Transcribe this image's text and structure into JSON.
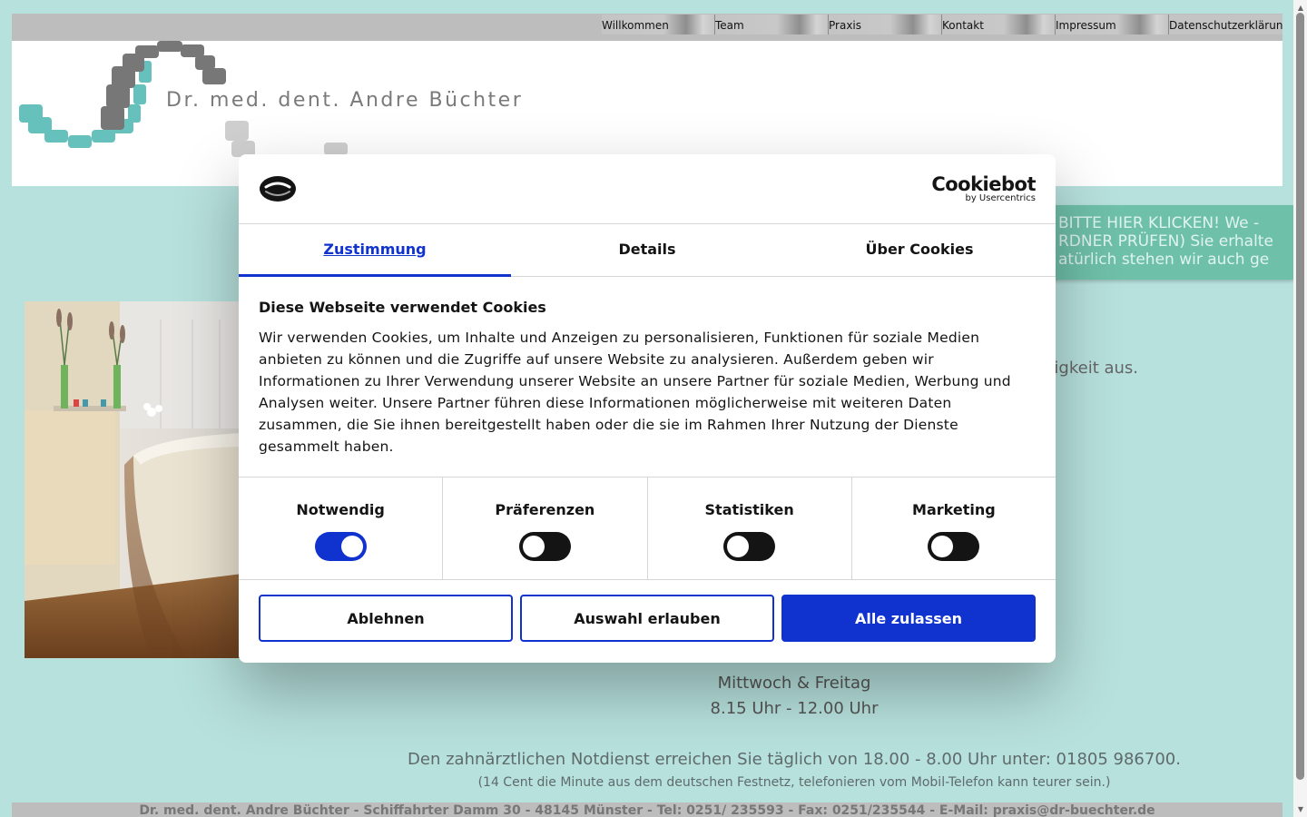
{
  "nav": {
    "items": [
      "Willkommen",
      "Team",
      "Praxis",
      "Kontakt",
      "Impressum",
      "Datenschutzerklärung"
    ]
  },
  "header": {
    "brand_name": "Dr. med. dent. Andre Büchter"
  },
  "banner": {
    "line1": "- BITTE HIER KLICKEN! We",
    "line2": "RDNER PRÜFEN) Sie erhalte",
    "line3": "atürlich stehen wir auch ge"
  },
  "main": {
    "intro_tail": "digkeit aus.",
    "hours_days": "Mittwoch & Freitag",
    "hours_time": "8.15 Uhr - 12.00 Uhr",
    "emergency": "Den zahnärztlichen Notdienst erreichen Sie täglich von 18.00 - 8.00 Uhr unter: 01805 986700.",
    "emergency_note": "(14 Cent die Minute aus dem deutschen Festnetz, telefonieren vom Mobil-Telefon kann teurer sein.)"
  },
  "footer": {
    "text": "Dr. med. dent. Andre Büchter - Schiffahrter Damm 30 - 48145 Münster - Tel: 0251/ 235593 - Fax: 0251/235544 - E-Mail: praxis@dr-buechter.de"
  },
  "cookie_dialog": {
    "brand_main": "Cookiebot",
    "brand_sub": "by Usercentrics",
    "tabs": [
      "Zustimmung",
      "Details",
      "Über Cookies"
    ],
    "active_tab": "Zustimmung",
    "title": "Diese Webseite verwendet Cookies",
    "text": "Wir verwenden Cookies, um Inhalte und Anzeigen zu personalisieren, Funktionen für soziale Medien anbieten zu können und die Zugriffe auf unsere Website zu analysieren. Außerdem geben wir Informationen zu Ihrer Verwendung unserer Website an unsere Partner für soziale Medien, Werbung und Analysen weiter. Unsere Partner führen diese Informationen möglicherweise mit weiteren Daten zusammen, die Sie ihnen bereitgestellt haben oder die sie im Rahmen Ihrer Nutzung der Dienste gesammelt haben.",
    "toggles": [
      {
        "label": "Notwendig",
        "checked": true
      },
      {
        "label": "Präferenzen",
        "checked": false
      },
      {
        "label": "Statistiken",
        "checked": false
      },
      {
        "label": "Marketing",
        "checked": false
      }
    ],
    "buttons": {
      "decline": "Ablehnen",
      "allow_selection": "Auswahl erlauben",
      "allow_all": "Alle zulassen"
    }
  },
  "colors": {
    "page_background": "#b7e1dd",
    "accent_blue": "#1032cf",
    "banner_green": "#6fc0a9"
  }
}
